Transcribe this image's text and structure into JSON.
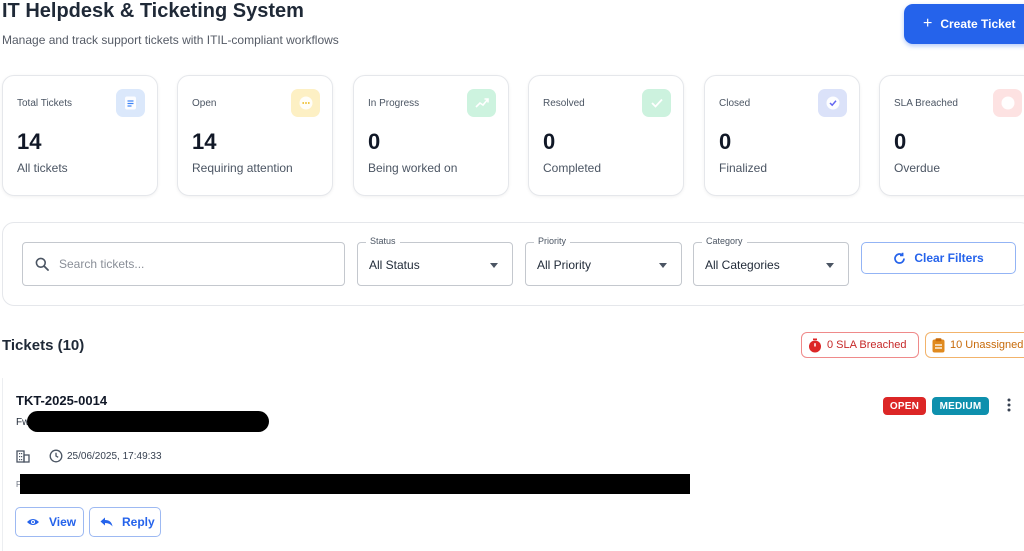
{
  "header": {
    "title": "IT Helpdesk & Ticketing System",
    "subtitle": "Manage and track support tickets with ITIL-compliant workflows",
    "create_button": "Create Ticket"
  },
  "stats": [
    {
      "label": "Total Tickets",
      "value": "14",
      "desc": "All tickets",
      "icon": "document-icon",
      "bg": "#dbe8fb",
      "fg": "#3b82f6"
    },
    {
      "label": "Open",
      "value": "14",
      "desc": "Requiring attention",
      "icon": "dots-icon",
      "bg": "#fdf0c4",
      "fg": "#eab308"
    },
    {
      "label": "In Progress",
      "value": "0",
      "desc": "Being worked on",
      "icon": "trend-icon",
      "bg": "#cdf3df",
      "fg": "#22c55e"
    },
    {
      "label": "Resolved",
      "value": "0",
      "desc": "Completed",
      "icon": "check-icon",
      "bg": "#ccf2de",
      "fg": "#22c55e"
    },
    {
      "label": "Closed",
      "value": "0",
      "desc": "Finalized",
      "icon": "verified-icon",
      "bg": "#dbe2f9",
      "fg": "#6366f1"
    },
    {
      "label": "SLA Breached",
      "value": "0",
      "desc": "Overdue",
      "icon": "alert-icon",
      "bg": "#fde2e2",
      "fg": "#ef4444"
    }
  ],
  "filters": {
    "search_placeholder": "Search tickets...",
    "status_label": "Status",
    "status_value": "All Status",
    "priority_label": "Priority",
    "priority_value": "All Priority",
    "category_label": "Category",
    "category_value": "All Categories",
    "clear_button": "Clear Filters"
  },
  "tickets_section": {
    "heading": "Tickets (10)",
    "sla_chip": "0 SLA Breached",
    "unassigned_chip": "10 Unassigned"
  },
  "ticket": {
    "id": "TKT-2025-0014",
    "subject_prefix": "Fw",
    "datetime": "25/06/2025, 17:49:33",
    "desc_prefix": "F",
    "status_badge": "OPEN",
    "priority_badge": "MEDIUM",
    "view_button": "View",
    "reply_button": "Reply"
  },
  "colors": {
    "primary": "#2563eb",
    "open_badge": "#dc2626",
    "medium_badge": "#0e90ad"
  }
}
